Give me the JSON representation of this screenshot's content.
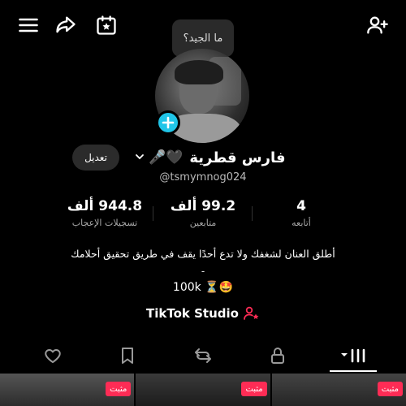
{
  "header": {
    "icons": [
      "menu-icon",
      "share-icon",
      "calendar-star-icon",
      "add-friend-icon"
    ]
  },
  "bubble": {
    "text": "ما الجيد؟"
  },
  "profile": {
    "name": "فارس قطرية",
    "name_emojis": "🎤🖤",
    "handle": "@tsmymnog024",
    "edit_label": "تعديل"
  },
  "stats": [
    {
      "value": "4",
      "label": "أتابعه"
    },
    {
      "value": "99.2 ألف",
      "label": "متابعين"
    },
    {
      "value": "944.8 ألف",
      "label": "تسجيلات الإعجاب"
    }
  ],
  "bio": {
    "line1": "أطلق العنان لشغفك ولا تدع أحدًا يقف في طريق تحقيق أحلامك",
    "dash": "-",
    "views": "100k ⏳🤩"
  },
  "studio": {
    "label": "TikTok Studio"
  },
  "tabs": [
    "videos-grid-tab",
    "private-tab",
    "reposts-tab",
    "favorites-tab",
    "liked-tab"
  ],
  "grid": {
    "pinned_label": "مثبت"
  },
  "colors": {
    "accent": "#fe2c55",
    "add": "#20c5e8",
    "background": "#000000"
  }
}
